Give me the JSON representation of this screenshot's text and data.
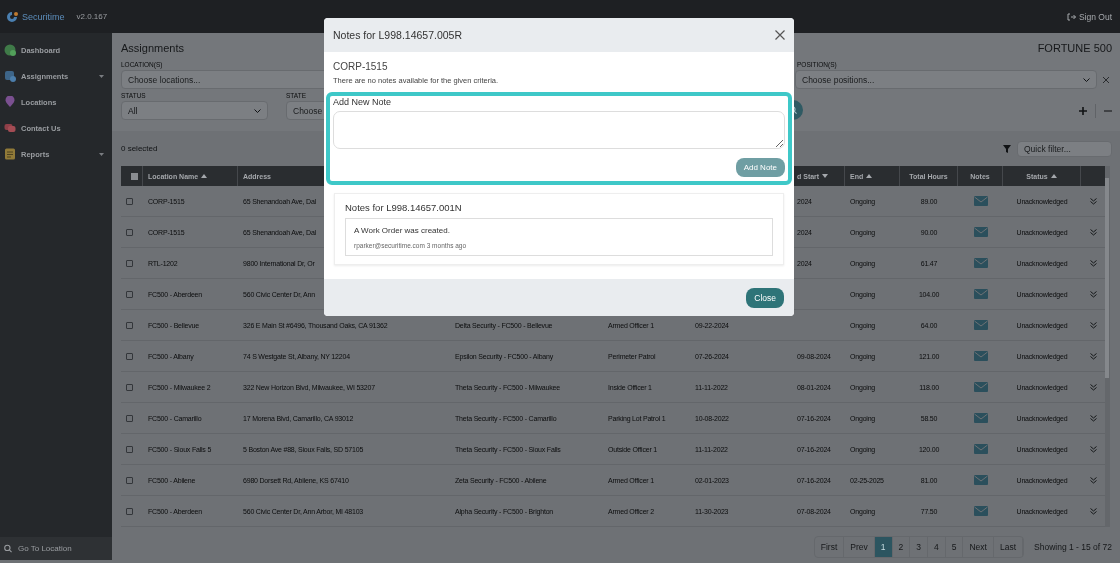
{
  "app": {
    "logo": "Securitime",
    "version": "v2.0.167",
    "sign_out": "Sign Out"
  },
  "sidebar": {
    "items": [
      {
        "label": "Dashboard",
        "expandable": false
      },
      {
        "label": "Assignments",
        "expandable": true
      },
      {
        "label": "Locations",
        "expandable": false
      },
      {
        "label": "Contact Us",
        "expandable": false
      },
      {
        "label": "Reports",
        "expandable": true
      }
    ],
    "search": {
      "placeholder": "Go To Location"
    }
  },
  "page": {
    "title": "Assignments",
    "client": "FORTUNE 500"
  },
  "filters": {
    "locations": {
      "label": "LOCATION(S)",
      "placeholder": "Choose locations..."
    },
    "positions": {
      "label": "POSITION(S)",
      "placeholder": "Choose positions..."
    },
    "status": {
      "label": "STATUS",
      "value": "All"
    },
    "state": {
      "label": "STATE",
      "placeholder": "Choose"
    }
  },
  "table": {
    "selected_count": "0 selected",
    "quick_filter": {
      "placeholder": "Quick filter..."
    },
    "columns": [
      {
        "label": "Location Name",
        "sorted": true,
        "descending": false
      },
      {
        "label": "Address",
        "sorted": false
      },
      {
        "label": "d Start",
        "sorted": true,
        "descending": true
      },
      {
        "label": "End",
        "sorted": true,
        "descending": false
      },
      {
        "label": "Total Hours",
        "sorted": false
      },
      {
        "label": "Notes",
        "sorted": false
      },
      {
        "label": "Status",
        "sorted": true,
        "descending": false
      }
    ],
    "select_all": {
      "checked": false
    },
    "rows": [
      {
        "checked": false,
        "location": "CORP-1515",
        "address": "65 Shenandoah Ave, Dal",
        "scheduled_start": "2024",
        "end": "Ongoing",
        "total_hours": "89.00",
        "status": "Unacknowledged"
      },
      {
        "checked": false,
        "location": "CORP-1515",
        "address": "65 Shenandoah Ave, Dal",
        "scheduled_start": "2024",
        "end": "Ongoing",
        "total_hours": "90.00",
        "status": "Unacknowledged"
      },
      {
        "checked": false,
        "location": "RTL-1202",
        "address": "9800 International Dr, Or",
        "scheduled_start": "2024",
        "end": "Ongoing",
        "total_hours": "61.47",
        "status": "Unacknowledged"
      },
      {
        "checked": false,
        "location": "FC500 - Aberdeen",
        "address": "560 Civic Center Dr, Ann",
        "end": "Ongoing",
        "total_hours": "104.00",
        "status": "Unacknowledged"
      },
      {
        "checked": false,
        "location": "FC500 - Bellevue",
        "address": "326 E Main St #6496, Thousand Oaks, CA 91362",
        "vendor": "Delta Security - FC500 - Bellevue",
        "position": "Armed Officer 1",
        "start": "09-22-2024",
        "end": "Ongoing",
        "total_hours": "64.00",
        "status": "Unacknowledged"
      },
      {
        "checked": false,
        "location": "FC500 - Albany",
        "address": "74 S Westgate St, Albany, NY 12204",
        "vendor": "Epsilon Security - FC500 - Albany",
        "position": "Perimeter Patrol",
        "start": "07-26-2024",
        "scheduled_start": "09-08-2024",
        "end": "Ongoing",
        "total_hours": "121.00",
        "status": "Unacknowledged"
      },
      {
        "checked": false,
        "location": "FC500 - Milwaukee 2",
        "address": "322 New Horizon Blvd, Milwaukee, WI 53207",
        "vendor": "Theta Security - FC500 - Milwaukee",
        "position": "Inside Officer 1",
        "start": "11-11-2022",
        "scheduled_start": "08-01-2024",
        "end": "Ongoing",
        "total_hours": "118.00",
        "status": "Unacknowledged"
      },
      {
        "checked": false,
        "location": "FC500 - Camarillo",
        "address": "17 Morena Blvd, Camarillo, CA 93012",
        "vendor": "Theta Security - FC500 - Camarillo",
        "position": "Parking Lot Patrol 1",
        "start": "10-08-2022",
        "scheduled_start": "07-16-2024",
        "end": "Ongoing",
        "total_hours": "58.50",
        "status": "Unacknowledged"
      },
      {
        "checked": false,
        "location": "FC500 - Sioux Falls 5",
        "address": "5 Boston Ave #88, Sioux Falls, SD 57105",
        "vendor": "Theta Security - FC500 - Sioux Falls",
        "position": "Outside Officer 1",
        "start": "11-11-2022",
        "scheduled_start": "07-16-2024",
        "end": "Ongoing",
        "total_hours": "120.00",
        "status": "Unacknowledged"
      },
      {
        "checked": false,
        "location": "FC500 - Abilene",
        "address": "6980 Dorsett Rd, Abilene, KS 67410",
        "vendor": "Zeta Security - FC500 - Abilene",
        "position": "Armed Officer 1",
        "start": "02-01-2023",
        "scheduled_start": "07-16-2024",
        "end": "02-25-2025",
        "total_hours": "81.00",
        "status": "Unacknowledged"
      },
      {
        "checked": false,
        "location": "FC500 - Aberdeen",
        "address": "560 Civic Center Dr, Ann Arbor, MI 48103",
        "vendor": "Alpha Security - FC500 - Brighton",
        "position": "Armed Officer 2",
        "start": "11-30-2023",
        "scheduled_start": "07-08-2024",
        "end": "Ongoing",
        "total_hours": "77.50",
        "status": "Unacknowledged"
      }
    ]
  },
  "pagination": {
    "pages": [
      {
        "label": "First",
        "selected": false
      },
      {
        "label": "Prev",
        "selected": false
      },
      {
        "label": "1",
        "selected": true
      },
      {
        "label": "2",
        "selected": false
      },
      {
        "label": "3",
        "selected": false
      },
      {
        "label": "4",
        "selected": false
      },
      {
        "label": "5",
        "selected": false
      },
      {
        "label": "Next",
        "selected": false
      },
      {
        "label": "Last",
        "selected": false
      }
    ],
    "summary": "Showing 1 - 15 of 72"
  },
  "modal": {
    "title": "Notes for L998.14657.005R",
    "location": "CORP-1515",
    "empty_message": "There are no notes available for the given criteria.",
    "new_note": {
      "label": "Add New Note",
      "button": {
        "label": "Add Note",
        "disabled": true
      }
    },
    "history": {
      "title": "Notes for L998.14657.001N",
      "notes": [
        {
          "text": "A Work Order was created.",
          "meta": "rparker@securitime.com 3 months ago"
        }
      ]
    },
    "close_label": "Close"
  }
}
